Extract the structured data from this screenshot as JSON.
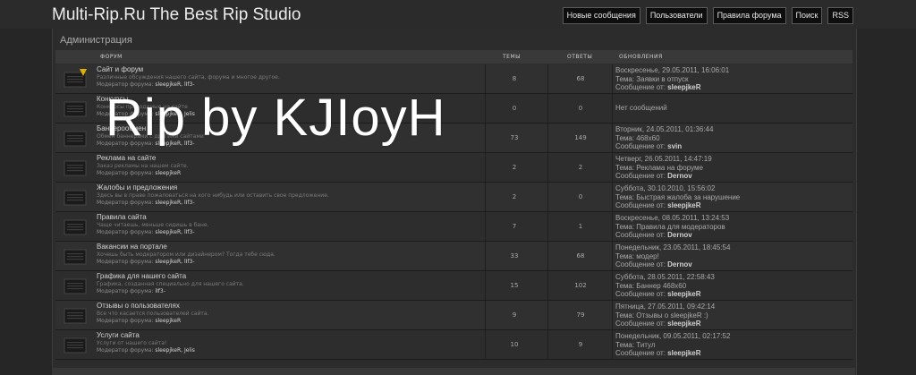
{
  "header": {
    "title": "Multi-Rip.Ru The Best Rip Studio",
    "nav": [
      "Новые сообщения",
      "Пользователи",
      "Правила форума",
      "Поиск",
      "RSS"
    ]
  },
  "category": {
    "title": "Администрация"
  },
  "columns": {
    "forum": "ФОРУМ",
    "topics": "ТЕМЫ",
    "posts": "ОТВЕТЫ",
    "last": "ОБНОВЛЕНИЯ"
  },
  "forums": [
    {
      "name": "Сайт и форум",
      "desc": "Различные обсуждения нашего сайта, форума и многое другое.",
      "mods_label": "Модератор форума:",
      "mods": "sleepjkeR, lIf3-",
      "topics": "8",
      "posts": "68",
      "last_date": "Воскресенье, 29.05.2011, 16:06:01",
      "last_topic": "Тема: Заявки в отпуск",
      "last_author_label": "Сообщение от:",
      "last_author": "sleepjkeR",
      "unread": true
    },
    {
      "name": "Конкурсы",
      "desc": "Конкурсы проводимые на сайте",
      "mods_label": "Модератор форума:",
      "mods": "sleepjkeR, Jelis",
      "topics": "0",
      "posts": "0",
      "last_empty": "Нет сообщений"
    },
    {
      "name": "Баннерообмен",
      "desc": "Обмен баннерами с другими сайтами",
      "mods_label": "Модератор форума:",
      "mods": "sleepjkeR, lIf3-",
      "topics": "73",
      "posts": "149",
      "last_date": "Вторник, 24.05.2011, 01:36:44",
      "last_topic": "Тема: 468x60",
      "last_author_label": "Сообщение от:",
      "last_author": "svin"
    },
    {
      "name": "Реклама на сайте",
      "desc": "Заказ рекламы на нашем сайте.",
      "mods_label": "Модератор форума:",
      "mods": "sleepjkeR",
      "topics": "2",
      "posts": "2",
      "last_date": "Четверг, 26.05.2011, 14:47:19",
      "last_topic": "Тема: Реклама на форуме",
      "last_author_label": "Сообщение от:",
      "last_author": "Dernov"
    },
    {
      "name": "Жалобы и предложения",
      "desc": "Здесь вы в праве пожаловаться на кого нибудь или оставить свое предложение.",
      "mods_label": "Модератор форума:",
      "mods": "sleepjkeR, lIf3-",
      "topics": "2",
      "posts": "0",
      "last_date": "Суббота, 30.10.2010, 15:56:02",
      "last_topic": "Тема: Быстрая жалоба за нарушение",
      "last_author_label": "Сообщение от:",
      "last_author": "sleepjkeR"
    },
    {
      "name": "Правила сайта",
      "desc": "Чаще читаешь, меньше сидишь в бане.",
      "mods_label": "Модератор форума:",
      "mods": "sleepjkeR, lIf3-",
      "topics": "7",
      "posts": "1",
      "last_date": "Воскресенье, 08.05.2011, 13:24:53",
      "last_topic": "Тема: Правила для модераторов",
      "last_author_label": "Сообщение от:",
      "last_author": "Dernov"
    },
    {
      "name": "Вакансии на портале",
      "desc": "Хочешь быть модератором или дизайнером? Тогда тебе сюда.",
      "mods_label": "Модератор форума:",
      "mods": "sleepjkeR, lIf3-",
      "topics": "33",
      "posts": "68",
      "last_date": "Понедельник, 23.05.2011, 18:45:54",
      "last_topic": "Тема: модер!",
      "last_author_label": "Сообщение от:",
      "last_author": "Dernov"
    },
    {
      "name": "Графика для нашего сайта",
      "desc": "Графика, созданная специально для нашего сайта.",
      "mods_label": "Модератор форума:",
      "mods": "lIf3-",
      "topics": "15",
      "posts": "102",
      "last_date": "Суббота, 28.05.2011, 22:58:43",
      "last_topic": "Тема: Баннер 468x60",
      "last_author_label": "Сообщение от:",
      "last_author": "sleepjkeR"
    },
    {
      "name": "Отзывы о пользователях",
      "desc": "Все что касается пользователей сайта.",
      "mods_label": "Модератор форума:",
      "mods": "sleepjkeR",
      "topics": "9",
      "posts": "79",
      "last_date": "Пятница, 27.05.2011, 09:42:14",
      "last_topic": "Тема: Отзывы о sleepjkeR :)",
      "last_author_label": "Сообщение от:",
      "last_author": "sleepjkeR"
    },
    {
      "name": "Услуги сайта",
      "desc": "Услуги от нашего сайта!",
      "mods_label": "Модератор форума:",
      "mods": "sleepjkeR, Jelis",
      "topics": "10",
      "posts": "9",
      "last_date": "Понедельник, 09.05.2011, 02:17:52",
      "last_topic": "Тема: Титул",
      "last_author_label": "Сообщение от:",
      "last_author": "sleepjkeR"
    }
  ],
  "watermark": "Rip by KJIoyH",
  "colors": {
    "background": "#262626",
    "panel": "#2c2c2c",
    "accent": "#e0b000",
    "text": "#a9a9a9"
  },
  "icons": {
    "forum_read": "folder-icon",
    "forum_unread": "folder-new-icon"
  }
}
